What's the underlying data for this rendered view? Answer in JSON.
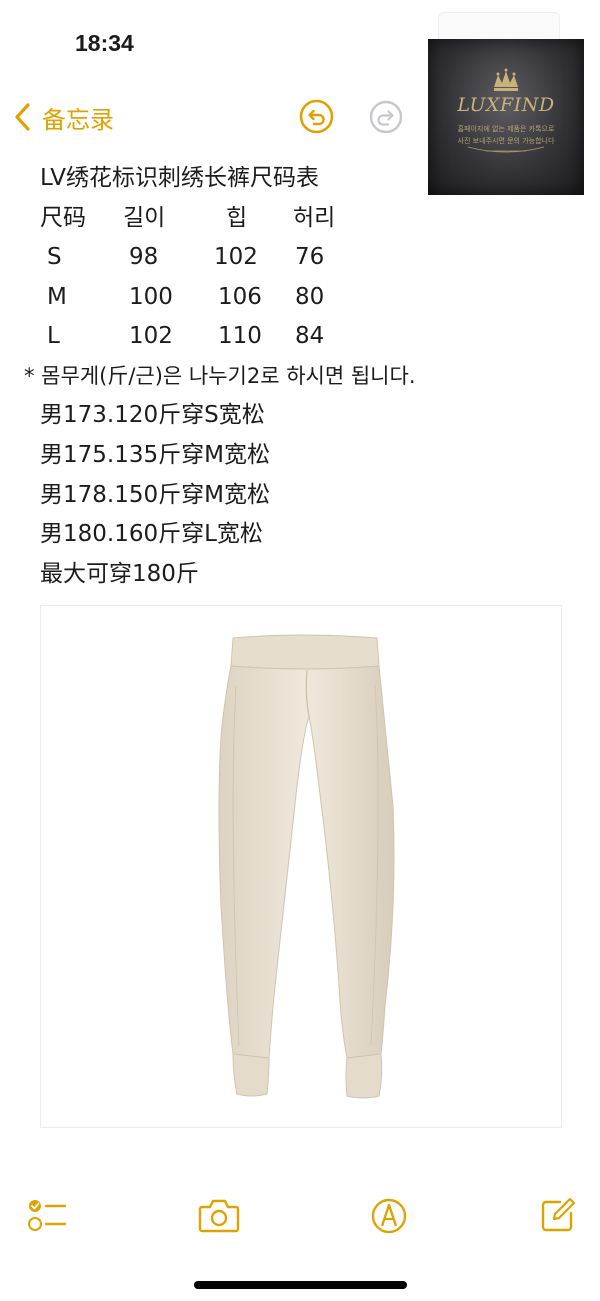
{
  "status_bar": {
    "time": "18:34"
  },
  "logo": {
    "brand": "LUXFIND",
    "tagline_line1": "홈페이지에 없는 제품은 카톡으로",
    "tagline_line2": "사진 보내주시면 문의 가능합니다"
  },
  "nav": {
    "back_label": "备忘录"
  },
  "note": {
    "title": "LV绣花标识刺绣长裤尺码表",
    "size_table": {
      "headers": [
        "尺码",
        "길이",
        "힙",
        "허리"
      ],
      "rows": [
        [
          "S",
          "98",
          "102",
          "76"
        ],
        [
          "M",
          "100",
          "106",
          "80"
        ],
        [
          "L",
          "102",
          "110",
          "84"
        ]
      ]
    },
    "weight_note": "* 몸무게(斤/근)은 나누기2로 하시면 됩니다.",
    "fit_lines": [
      "男173.120斤穿S宽松",
      "男175.135斤穿M宽松",
      "男178.150斤穿M宽松",
      "男180.160斤穿L宽松",
      "最大可穿180斤"
    ]
  },
  "product_image": {
    "subject": "cream jogger pants"
  },
  "toolbar": {
    "items": [
      "checklist-icon",
      "camera-icon",
      "markup-icon",
      "compose-icon"
    ]
  },
  "colors": {
    "accent": "#e0a200",
    "text": "#1c1c1e",
    "pants": "#ece4d6",
    "logo_gold": "#c9b27a"
  }
}
